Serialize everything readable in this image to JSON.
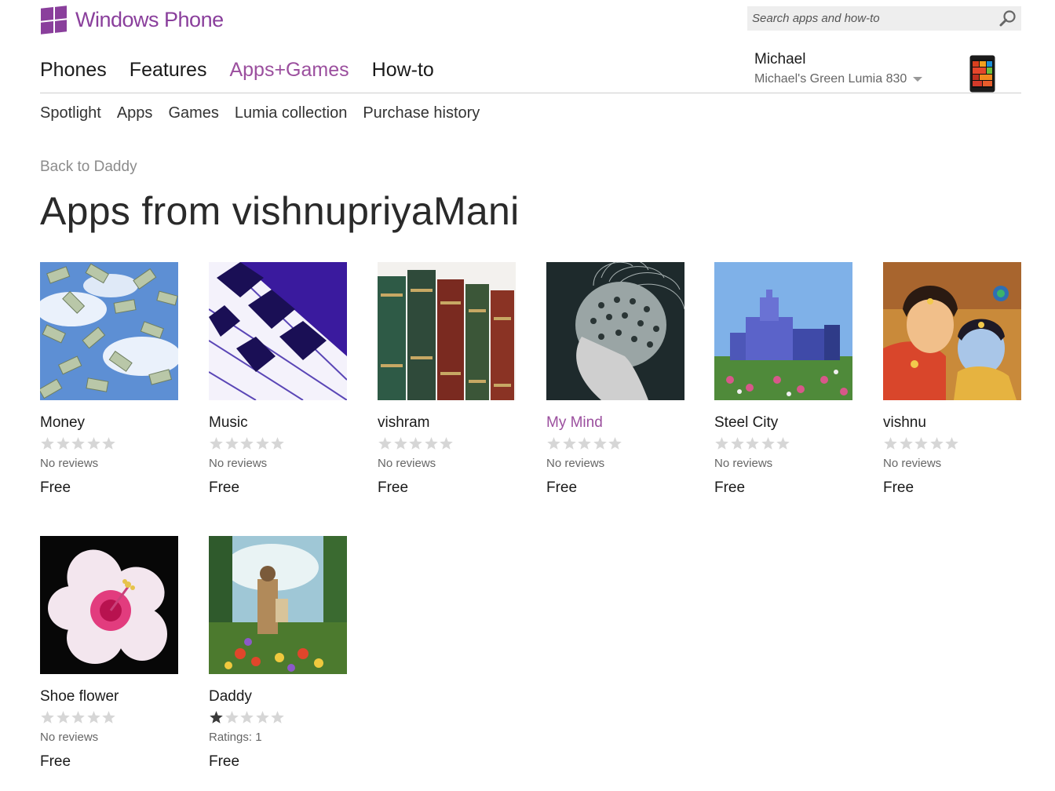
{
  "brand": {
    "name": "Windows Phone",
    "color": "#8a3f9c"
  },
  "search": {
    "placeholder": "Search apps and how-to",
    "icon": "search-icon"
  },
  "main_nav": [
    {
      "label": "Phones",
      "active": false
    },
    {
      "label": "Features",
      "active": false
    },
    {
      "label": "Apps+Games",
      "active": true
    },
    {
      "label": "How-to",
      "active": false
    }
  ],
  "account": {
    "name": "Michael",
    "phone": "Michael's Green Lumia 830"
  },
  "sub_nav": [
    "Spotlight",
    "Apps",
    "Games",
    "Lumia collection",
    "Purchase history"
  ],
  "back_link": "Back to Daddy",
  "page_title": "Apps from vishnupriyaMani",
  "accent_color": "#9b4f9e",
  "apps": [
    {
      "name": "Money",
      "rating": 0,
      "reviews": "No reviews",
      "price": "Free",
      "image": "money-image",
      "highlighted": false
    },
    {
      "name": "Music",
      "rating": 0,
      "reviews": "No reviews",
      "price": "Free",
      "image": "piano-keys-image",
      "highlighted": false
    },
    {
      "name": "vishram",
      "rating": 0,
      "reviews": "No reviews",
      "price": "Free",
      "image": "books-image",
      "highlighted": false
    },
    {
      "name": "My Mind",
      "rating": 0,
      "reviews": "No reviews",
      "price": "Free",
      "image": "brain-wires-image",
      "highlighted": true
    },
    {
      "name": "Steel City",
      "rating": 0,
      "reviews": "No reviews",
      "price": "Free",
      "image": "capitol-building-image",
      "highlighted": false
    },
    {
      "name": "vishnu",
      "rating": 0,
      "reviews": "No reviews",
      "price": "Free",
      "image": "krishna-painting-image",
      "highlighted": false
    },
    {
      "name": "Shoe flower",
      "rating": 0,
      "reviews": "No reviews",
      "price": "Free",
      "image": "hibiscus-flower-image",
      "highlighted": false
    },
    {
      "name": "Daddy",
      "rating": 1,
      "reviews": "Ratings: 1",
      "price": "Free",
      "image": "father-child-garden-image",
      "highlighted": false
    }
  ]
}
